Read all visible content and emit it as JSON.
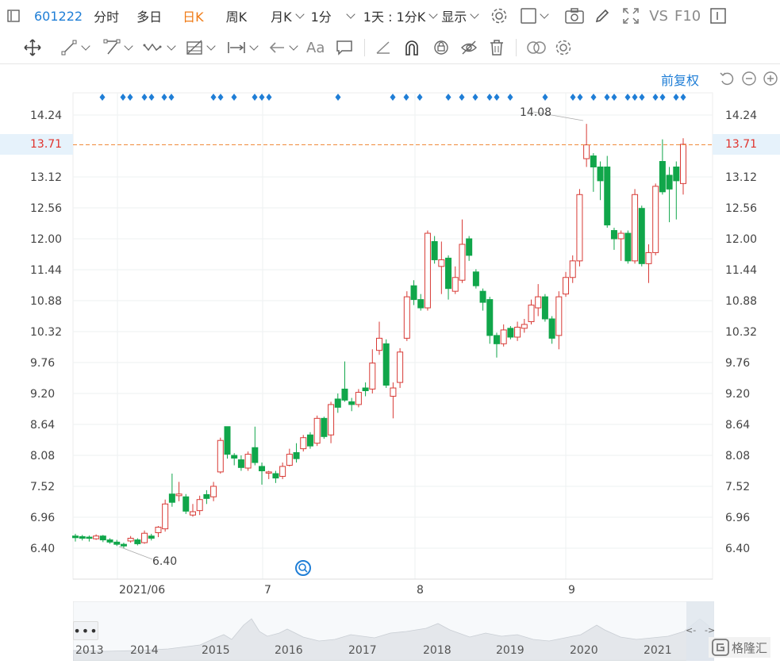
{
  "toolbar": {
    "code": "601222",
    "fenshi": "分时",
    "duori": "多日",
    "rik": "日K",
    "zhouk": "周K",
    "yuek": "月K",
    "min1": "1分",
    "range": "1天 : 1分K",
    "display": "显示",
    "vs": "VS",
    "f10": "F10"
  },
  "chart": {
    "adjust_label": "前复权",
    "current_price": "13.71",
    "high_label": "14.08",
    "low_label": "6.40",
    "y_ticks": [
      "14.24",
      "13.71",
      "13.12",
      "12.56",
      "12.00",
      "11.44",
      "10.88",
      "10.32",
      "9.76",
      "9.20",
      "8.64",
      "8.08",
      "7.52",
      "6.96",
      "6.40"
    ],
    "x_ticks": [
      "2021/06",
      "7",
      "8",
      "9"
    ]
  },
  "navigator": {
    "years": [
      "2013",
      "2014",
      "2015",
      "2016",
      "2017",
      "2018",
      "2019",
      "2020",
      "2021"
    ]
  },
  "brand": {
    "logo_text": "格隆汇"
  },
  "colors": {
    "up": "#d83a35",
    "down": "#10a64a",
    "accent": "#1f7ed6",
    "dash_line": "#f08a3a"
  },
  "chart_data": {
    "type": "candlestick",
    "ylim": [
      6.2,
      14.6
    ],
    "candles": [
      {
        "o": 6.62,
        "c": 6.59,
        "h": 6.66,
        "l": 6.52
      },
      {
        "o": 6.61,
        "c": 6.58,
        "h": 6.64,
        "l": 6.54
      },
      {
        "o": 6.6,
        "c": 6.58,
        "h": 6.63,
        "l": 6.52
      },
      {
        "o": 6.57,
        "c": 6.62,
        "h": 6.65,
        "l": 6.55
      },
      {
        "o": 6.62,
        "c": 6.55,
        "h": 6.64,
        "l": 6.51
      },
      {
        "o": 6.55,
        "c": 6.51,
        "h": 6.58,
        "l": 6.48
      },
      {
        "o": 6.51,
        "c": 6.47,
        "h": 6.55,
        "l": 6.44
      },
      {
        "o": 6.47,
        "c": 6.44,
        "h": 6.5,
        "l": 6.4
      },
      {
        "o": 6.53,
        "c": 6.58,
        "h": 6.62,
        "l": 6.5
      },
      {
        "o": 6.55,
        "c": 6.48,
        "h": 6.58,
        "l": 6.45
      },
      {
        "o": 6.5,
        "c": 6.67,
        "h": 6.72,
        "l": 6.48
      },
      {
        "o": 6.62,
        "c": 6.58,
        "h": 6.66,
        "l": 6.54
      },
      {
        "o": 6.68,
        "c": 6.78,
        "h": 6.8,
        "l": 6.6
      },
      {
        "o": 6.75,
        "c": 7.2,
        "h": 7.28,
        "l": 6.7
      },
      {
        "o": 7.38,
        "c": 7.23,
        "h": 7.75,
        "l": 7.15
      },
      {
        "o": 7.35,
        "c": 7.38,
        "h": 7.6,
        "l": 7.25
      },
      {
        "o": 7.33,
        "c": 7.07,
        "h": 7.38,
        "l": 7.02
      },
      {
        "o": 7.0,
        "c": 7.06,
        "h": 7.2,
        "l": 6.97
      },
      {
        "o": 7.08,
        "c": 7.28,
        "h": 7.35,
        "l": 7.0
      },
      {
        "o": 7.37,
        "c": 7.3,
        "h": 7.45,
        "l": 7.2
      },
      {
        "o": 7.33,
        "c": 7.52,
        "h": 7.6,
        "l": 7.25
      },
      {
        "o": 7.78,
        "c": 8.35,
        "h": 8.4,
        "l": 7.75
      },
      {
        "o": 8.6,
        "c": 8.1,
        "h": 8.6,
        "l": 8.02
      },
      {
        "o": 8.08,
        "c": 8.03,
        "h": 8.12,
        "l": 7.9
      },
      {
        "o": 8.0,
        "c": 7.86,
        "h": 8.08,
        "l": 7.8
      },
      {
        "o": 7.85,
        "c": 8.1,
        "h": 8.15,
        "l": 7.8
      },
      {
        "o": 8.22,
        "c": 7.95,
        "h": 8.6,
        "l": 7.9
      },
      {
        "o": 7.88,
        "c": 7.8,
        "h": 7.95,
        "l": 7.55
      },
      {
        "o": 7.76,
        "c": 7.78,
        "h": 7.8,
        "l": 7.65
      },
      {
        "o": 7.75,
        "c": 7.67,
        "h": 7.8,
        "l": 7.58
      },
      {
        "o": 7.7,
        "c": 7.88,
        "h": 7.95,
        "l": 7.65
      },
      {
        "o": 7.9,
        "c": 8.1,
        "h": 8.2,
        "l": 7.88
      },
      {
        "o": 8.13,
        "c": 8.02,
        "h": 8.3,
        "l": 7.95
      },
      {
        "o": 8.2,
        "c": 8.4,
        "h": 8.45,
        "l": 8.15
      },
      {
        "o": 8.45,
        "c": 8.25,
        "h": 8.5,
        "l": 8.2
      },
      {
        "o": 8.3,
        "c": 8.75,
        "h": 8.8,
        "l": 8.25
      },
      {
        "o": 8.75,
        "c": 8.42,
        "h": 8.78,
        "l": 8.38
      },
      {
        "o": 8.45,
        "c": 9.0,
        "h": 9.05,
        "l": 8.3
      },
      {
        "o": 9.1,
        "c": 8.95,
        "h": 9.2,
        "l": 8.85
      },
      {
        "o": 9.28,
        "c": 9.08,
        "h": 9.78,
        "l": 9.05
      },
      {
        "o": 9.05,
        "c": 9.0,
        "h": 9.12,
        "l": 8.88
      },
      {
        "o": 9.0,
        "c": 9.22,
        "h": 9.28,
        "l": 8.95
      },
      {
        "o": 9.3,
        "c": 9.25,
        "h": 9.4,
        "l": 9.15
      },
      {
        "o": 9.28,
        "c": 9.75,
        "h": 10.0,
        "l": 9.2
      },
      {
        "o": 9.98,
        "c": 10.2,
        "h": 10.5,
        "l": 9.9
      },
      {
        "o": 10.1,
        "c": 9.35,
        "h": 10.18,
        "l": 9.3
      },
      {
        "o": 9.15,
        "c": 9.3,
        "h": 9.4,
        "l": 8.75
      },
      {
        "o": 9.4,
        "c": 9.95,
        "h": 10.02,
        "l": 9.3
      },
      {
        "o": 10.2,
        "c": 10.95,
        "h": 11.05,
        "l": 10.15
      },
      {
        "o": 11.15,
        "c": 10.9,
        "h": 11.25,
        "l": 10.8
      },
      {
        "o": 10.9,
        "c": 10.75,
        "h": 11.0,
        "l": 10.7
      },
      {
        "o": 10.75,
        "c": 12.1,
        "h": 12.15,
        "l": 10.7
      },
      {
        "o": 11.95,
        "c": 11.62,
        "h": 12.05,
        "l": 11.55
      },
      {
        "o": 11.5,
        "c": 11.62,
        "h": 11.95,
        "l": 11.0
      },
      {
        "o": 11.65,
        "c": 11.1,
        "h": 11.7,
        "l": 10.9
      },
      {
        "o": 11.05,
        "c": 11.3,
        "h": 11.5,
        "l": 11.0
      },
      {
        "o": 11.25,
        "c": 11.9,
        "h": 12.35,
        "l": 11.2
      },
      {
        "o": 12.0,
        "c": 11.7,
        "h": 12.05,
        "l": 11.6
      },
      {
        "o": 11.4,
        "c": 11.15,
        "h": 11.45,
        "l": 11.1
      },
      {
        "o": 11.05,
        "c": 10.85,
        "h": 11.1,
        "l": 10.7
      },
      {
        "o": 10.9,
        "c": 10.25,
        "h": 10.95,
        "l": 10.1
      },
      {
        "o": 10.25,
        "c": 10.1,
        "h": 10.3,
        "l": 9.85
      },
      {
        "o": 10.1,
        "c": 10.35,
        "h": 10.45,
        "l": 10.05
      },
      {
        "o": 10.38,
        "c": 10.22,
        "h": 10.42,
        "l": 10.18
      },
      {
        "o": 10.22,
        "c": 10.4,
        "h": 10.5,
        "l": 10.15
      },
      {
        "o": 10.38,
        "c": 10.45,
        "h": 10.55,
        "l": 10.3
      },
      {
        "o": 10.5,
        "c": 10.8,
        "h": 10.9,
        "l": 10.45
      },
      {
        "o": 10.75,
        "c": 10.95,
        "h": 11.18,
        "l": 10.6
      },
      {
        "o": 10.95,
        "c": 10.55,
        "h": 11.0,
        "l": 10.5
      },
      {
        "o": 10.55,
        "c": 10.2,
        "h": 10.6,
        "l": 10.1
      },
      {
        "o": 10.25,
        "c": 10.95,
        "h": 11.05,
        "l": 10.0
      },
      {
        "o": 11.0,
        "c": 11.3,
        "h": 11.4,
        "l": 10.95
      },
      {
        "o": 11.3,
        "c": 11.6,
        "h": 11.7,
        "l": 11.2
      },
      {
        "o": 11.6,
        "c": 12.8,
        "h": 12.9,
        "l": 11.5
      },
      {
        "o": 13.45,
        "c": 13.7,
        "h": 14.08,
        "l": 13.3
      },
      {
        "o": 13.5,
        "c": 13.3,
        "h": 13.55,
        "l": 12.85
      },
      {
        "o": 13.3,
        "c": 13.05,
        "h": 13.4,
        "l": 12.7
      },
      {
        "o": 13.3,
        "c": 12.25,
        "h": 13.5,
        "l": 12.2
      },
      {
        "o": 12.15,
        "c": 12.0,
        "h": 12.2,
        "l": 11.8
      },
      {
        "o": 12.0,
        "c": 12.1,
        "h": 12.15,
        "l": 11.6
      },
      {
        "o": 12.1,
        "c": 11.6,
        "h": 12.15,
        "l": 11.55
      },
      {
        "o": 11.6,
        "c": 12.8,
        "h": 12.9,
        "l": 11.55
      },
      {
        "o": 12.55,
        "c": 11.55,
        "h": 12.6,
        "l": 11.5
      },
      {
        "o": 11.55,
        "c": 11.75,
        "h": 11.9,
        "l": 11.2
      },
      {
        "o": 11.75,
        "c": 12.95,
        "h": 13.0,
        "l": 11.7
      },
      {
        "o": 13.4,
        "c": 12.85,
        "h": 13.8,
        "l": 12.8
      },
      {
        "o": 13.15,
        "c": 12.9,
        "h": 13.3,
        "l": 12.3
      },
      {
        "o": 13.3,
        "c": 13.05,
        "h": 13.4,
        "l": 12.35
      },
      {
        "o": 13.0,
        "c": 13.71,
        "h": 13.82,
        "l": 12.8
      }
    ]
  }
}
